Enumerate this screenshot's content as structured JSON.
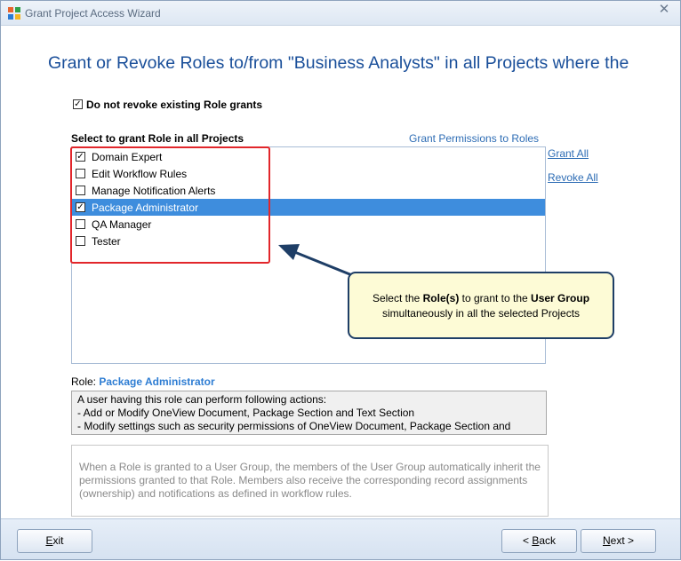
{
  "window": {
    "title": "Grant Project Access Wizard",
    "close_glyph": "✕"
  },
  "heading": "Grant or Revoke Roles to/from \"Business Analysts\" in all Projects where the",
  "do_not_revoke": {
    "label": "Do not revoke existing Role grants",
    "checked": true
  },
  "select_label": "Select to grant Role in all Projects",
  "permissions_link": "Grant Permissions to Roles",
  "roles": [
    {
      "label": "Domain Expert",
      "checked": true,
      "selected": false
    },
    {
      "label": "Edit Workflow Rules",
      "checked": false,
      "selected": false
    },
    {
      "label": "Manage Notification Alerts",
      "checked": false,
      "selected": false
    },
    {
      "label": "Package Administrator",
      "checked": true,
      "selected": true
    },
    {
      "label": "QA Manager",
      "checked": false,
      "selected": false
    },
    {
      "label": "Tester",
      "checked": false,
      "selected": false
    }
  ],
  "grant_all": "Grant All",
  "revoke_all": "Revoke All",
  "callout": {
    "part1": "Select the ",
    "bold1": "Role(s)",
    "part2": " to grant to the ",
    "bold2": "User Group",
    "line2": "simultaneously in all the selected Projects"
  },
  "role_caption": {
    "label": "Role:",
    "value": "Package Administrator"
  },
  "role_description": [
    "A user having this role can perform following actions:",
    "- Add or Modify OneView Document, Package Section and Text Section",
    "- Modify settings such as security permissions of OneView Document, Package Section and"
  ],
  "info_text": "When a Role is granted to a User Group, the members of the User Group automatically inherit the permissions granted to that Role. Members also receive the corresponding record assignments (ownership) and notifications as defined in workflow rules.",
  "buttons": {
    "exit": {
      "mnemonic": "E",
      "rest": "xit"
    },
    "back": {
      "prefix": "< ",
      "mnemonic": "B",
      "rest": "ack"
    },
    "next": {
      "mnemonic": "N",
      "rest": "ext >"
    }
  },
  "icons": {
    "app": "wizard-app-icon",
    "check": "✓",
    "scroll_up": "▲",
    "scroll_down": "▼"
  },
  "colors": {
    "heading": "#1a4f9a",
    "selection": "#3e8ddd",
    "highlight_box": "#e2262b",
    "callout_bg": "#fdfbd6"
  }
}
